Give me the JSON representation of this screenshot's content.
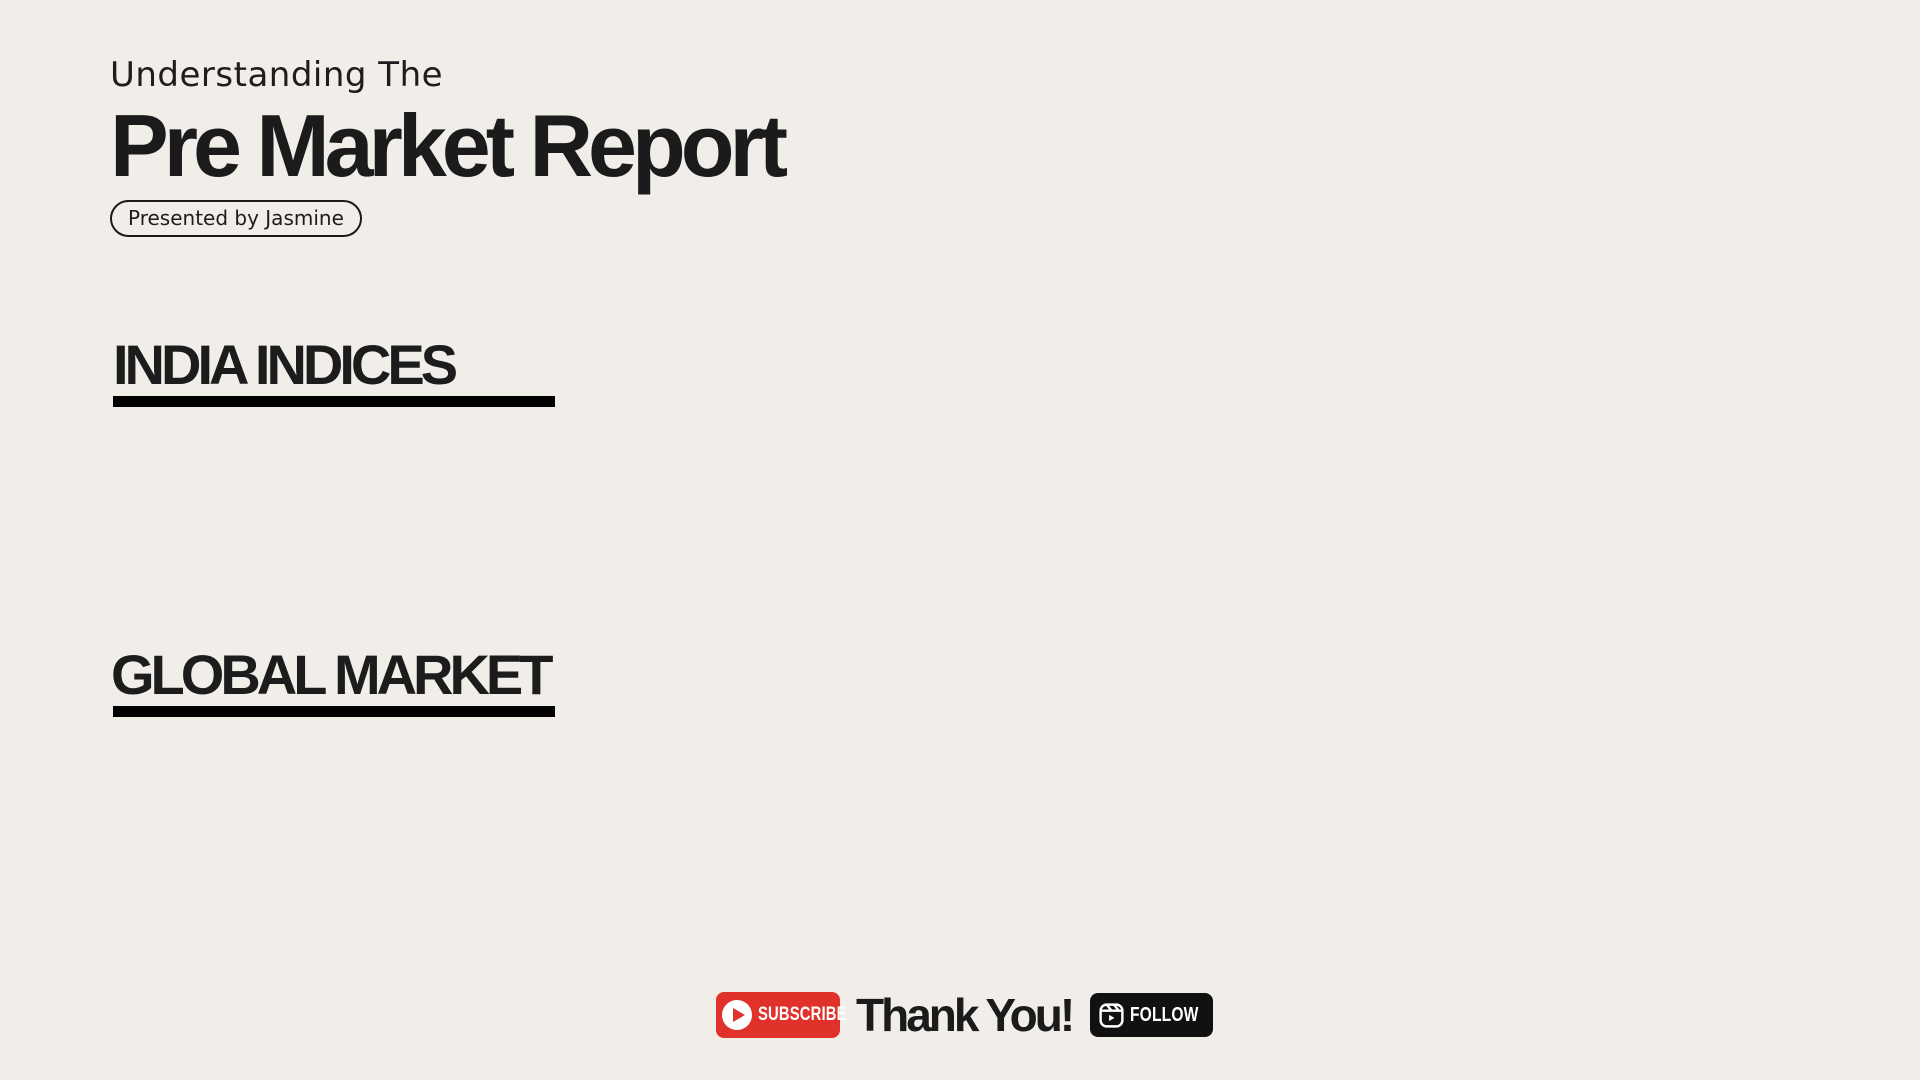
{
  "header": {
    "kicker": "Understanding The",
    "title": "Pre Market Report",
    "presenter": "Presented by Jasmine"
  },
  "sections": [
    {
      "title": "INDIA INDICES"
    },
    {
      "title": "GLOBAL MARKET"
    }
  ],
  "footer": {
    "subscribe_label": "SUBSCRIBE",
    "subscribe_icon": "youtube-play-icon",
    "thanks": "Thank You!",
    "follow_label": "FOLLOW",
    "follow_icon": "instagram-reels-icon"
  },
  "colors": {
    "background": "#f1eeea",
    "text": "#1b1b1b",
    "subscribe": "#e0322a",
    "follow": "#111111"
  }
}
